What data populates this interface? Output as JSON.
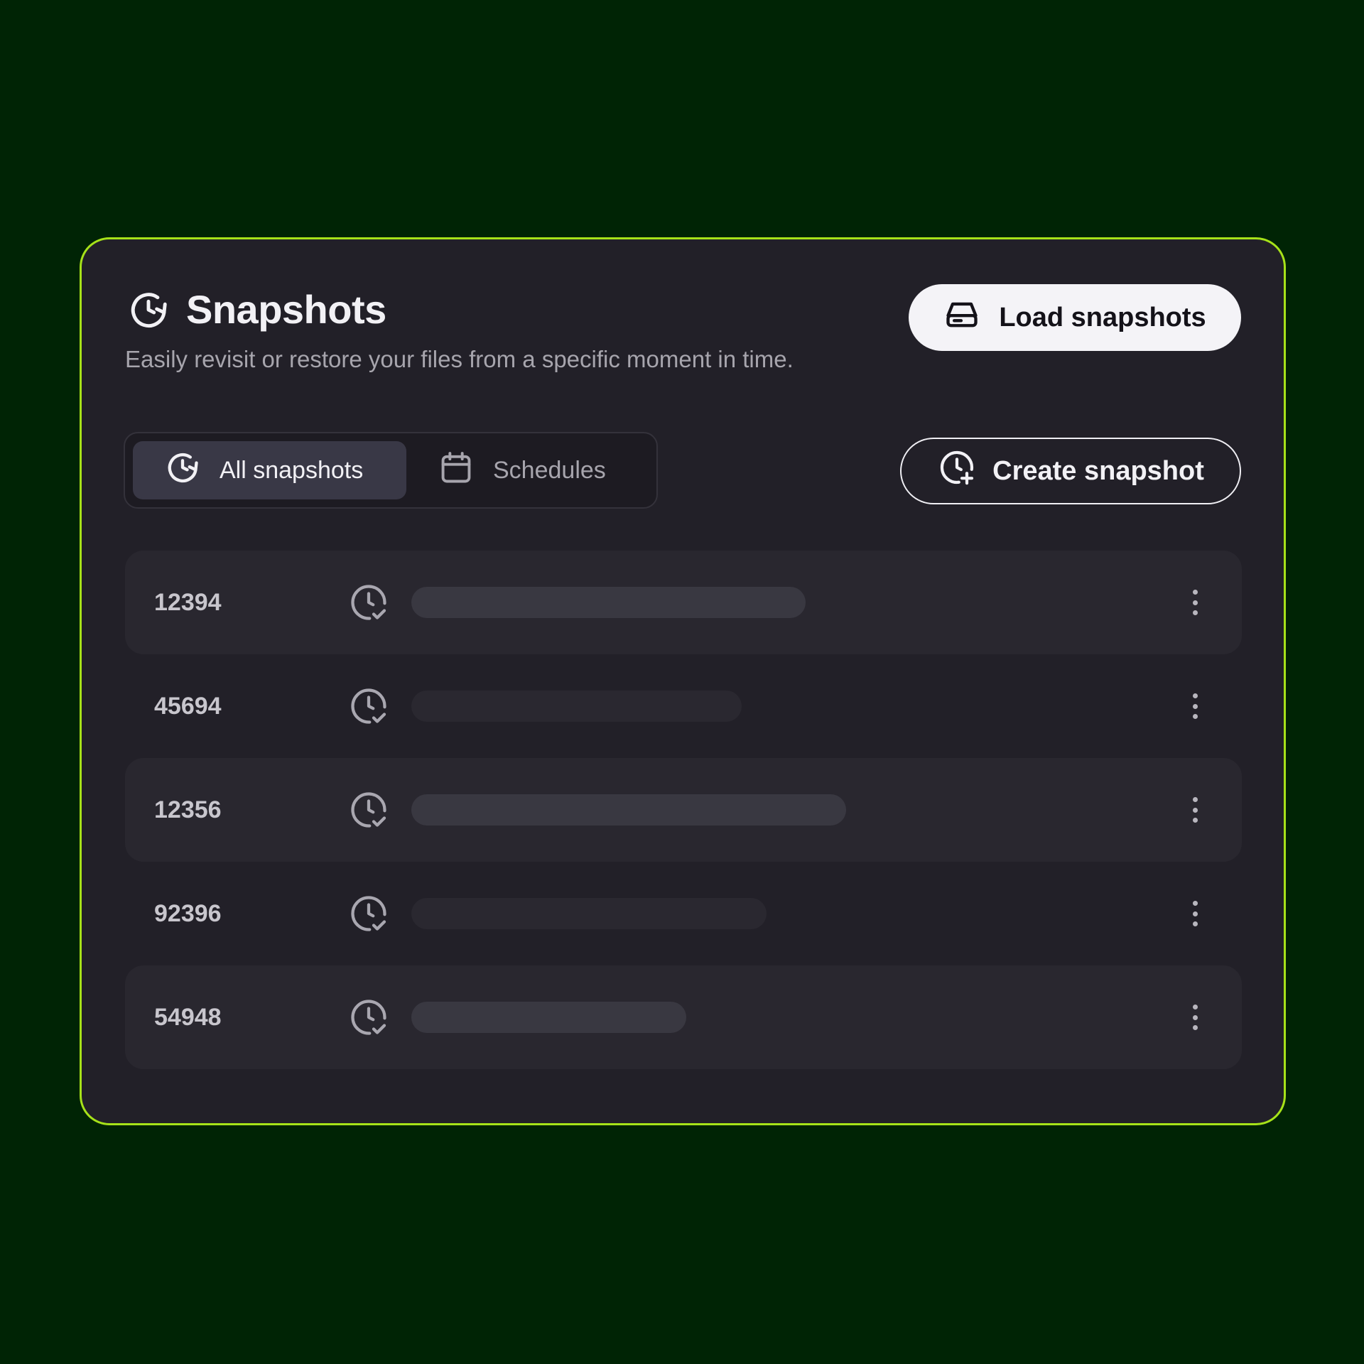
{
  "header": {
    "title": "Snapshots",
    "subtitle": "Easily revisit or restore your files from a specific moment in time.",
    "title_icon": "clock-refresh-icon"
  },
  "actions": {
    "load_label": "Load snapshots",
    "load_icon": "drive-icon",
    "create_label": "Create snapshot",
    "create_icon": "clock-plus-icon"
  },
  "tabs": [
    {
      "label": "All snapshots",
      "icon": "clock-refresh-icon",
      "active": true
    },
    {
      "label": "Schedules",
      "icon": "calendar-icon",
      "active": false
    }
  ],
  "snapshots": [
    {
      "id": "12394",
      "icon": "clock-check-icon"
    },
    {
      "id": "45694",
      "icon": "clock-check-icon"
    },
    {
      "id": "12356",
      "icon": "clock-check-icon"
    },
    {
      "id": "92396",
      "icon": "clock-check-icon"
    },
    {
      "id": "54948",
      "icon": "clock-check-icon"
    }
  ],
  "colors": {
    "background": "#002405",
    "card": "#222028",
    "accent_border": "#a6e219",
    "text_primary": "#f2f1f5",
    "text_secondary": "#a7a5ad"
  }
}
